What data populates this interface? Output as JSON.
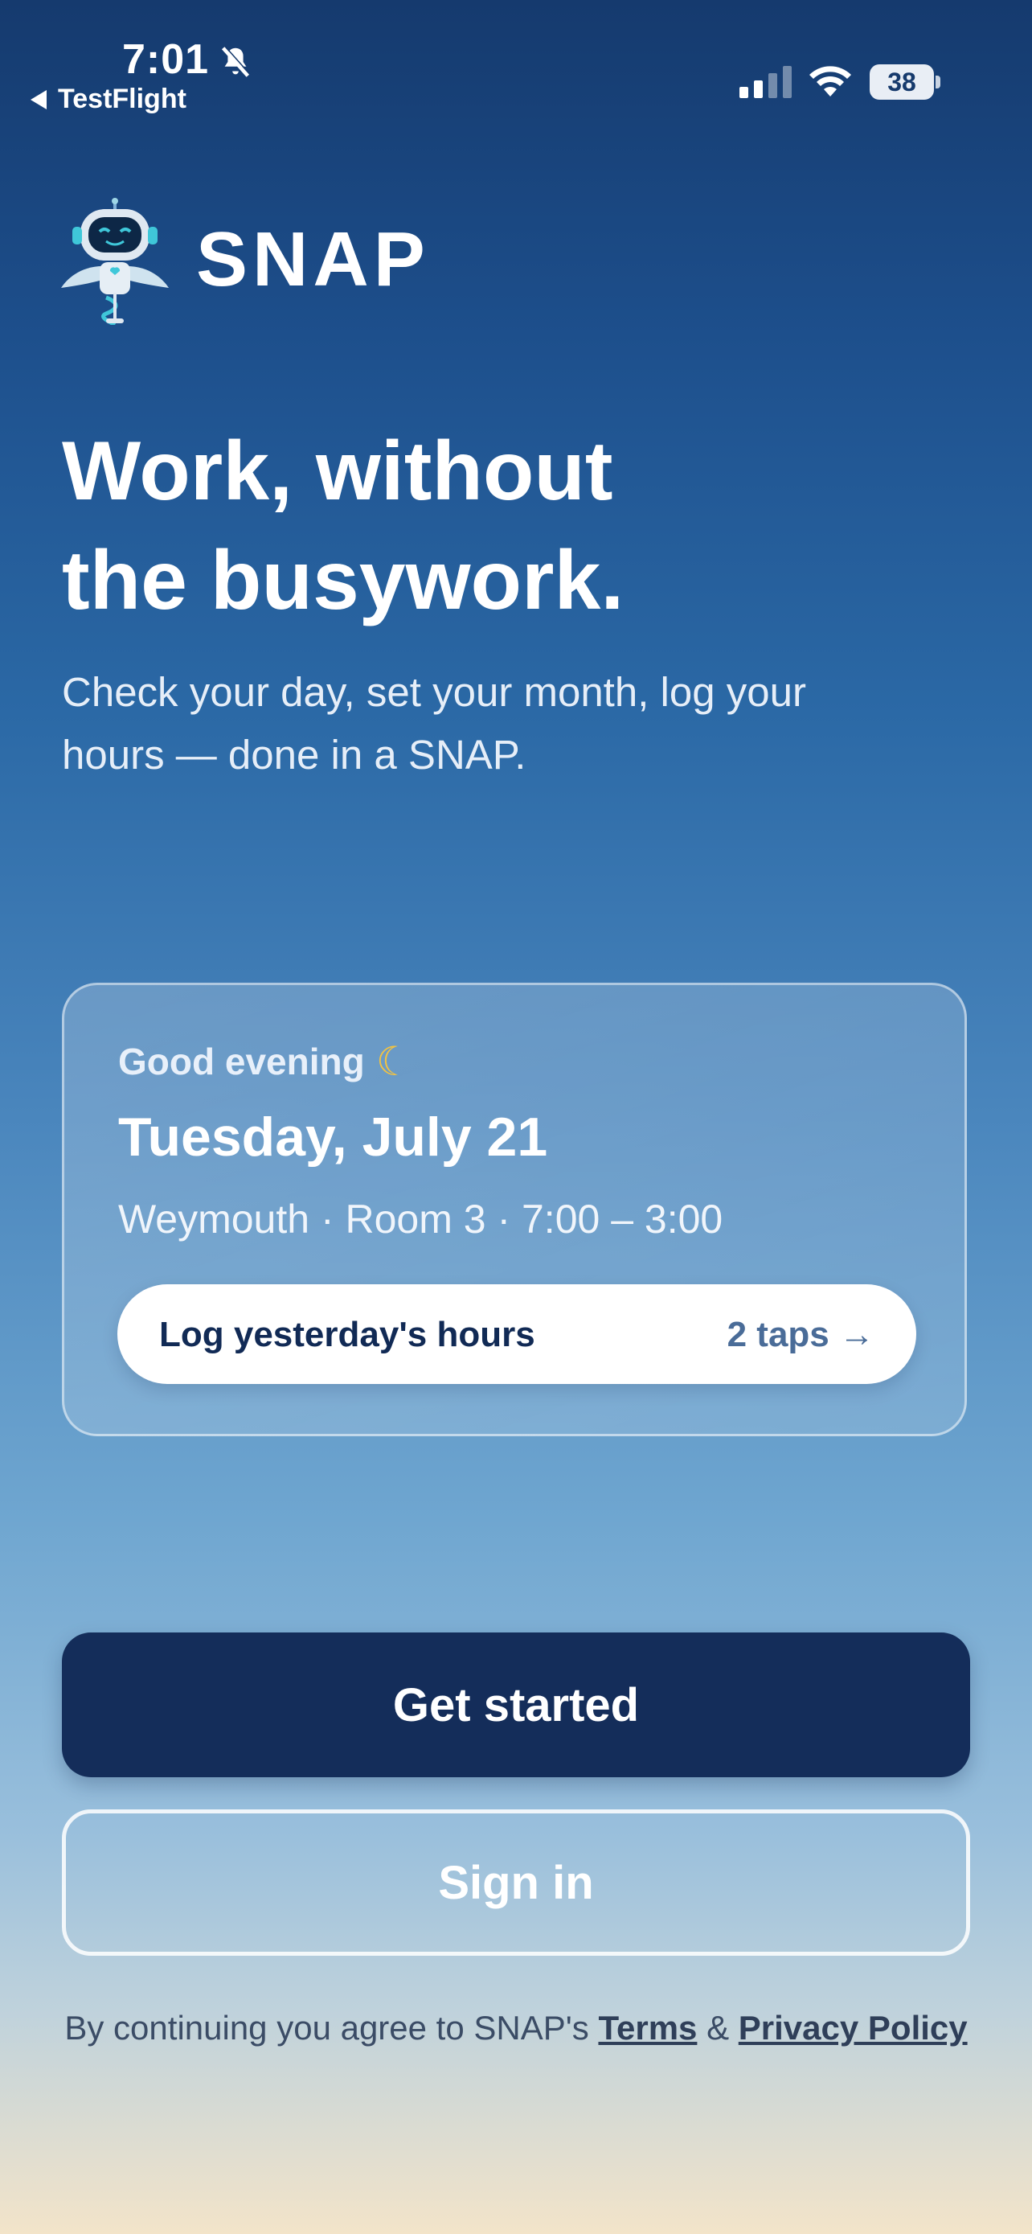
{
  "status_bar": {
    "time": "7:01",
    "back_app": "TestFlight",
    "battery": "38"
  },
  "brand": {
    "name": "SNAP"
  },
  "hero": {
    "headline_line1": "Work, without",
    "headline_line2": "the busywork.",
    "subtitle": "Check your day, set your month, log your hours — done in a SNAP."
  },
  "card": {
    "greeting": "Good evening",
    "greeting_icon": "crescent-moon-icon",
    "date": "Tuesday, July 21",
    "shift": "Weymouth · Room 3 · 7:00 – 3:00",
    "log_button_label": "Log yesterday's hours",
    "log_button_hint": "2 taps →"
  },
  "actions": {
    "primary": "Get started",
    "secondary": "Sign in"
  },
  "legal": {
    "prefix": "By continuing you agree to SNAP's",
    "terms": "Terms",
    "and": "&",
    "privacy": "Privacy Policy"
  },
  "colors": {
    "primary_button": "#142d5a",
    "moon": "#f3c341",
    "robot_accent": "#3fc7d9"
  }
}
